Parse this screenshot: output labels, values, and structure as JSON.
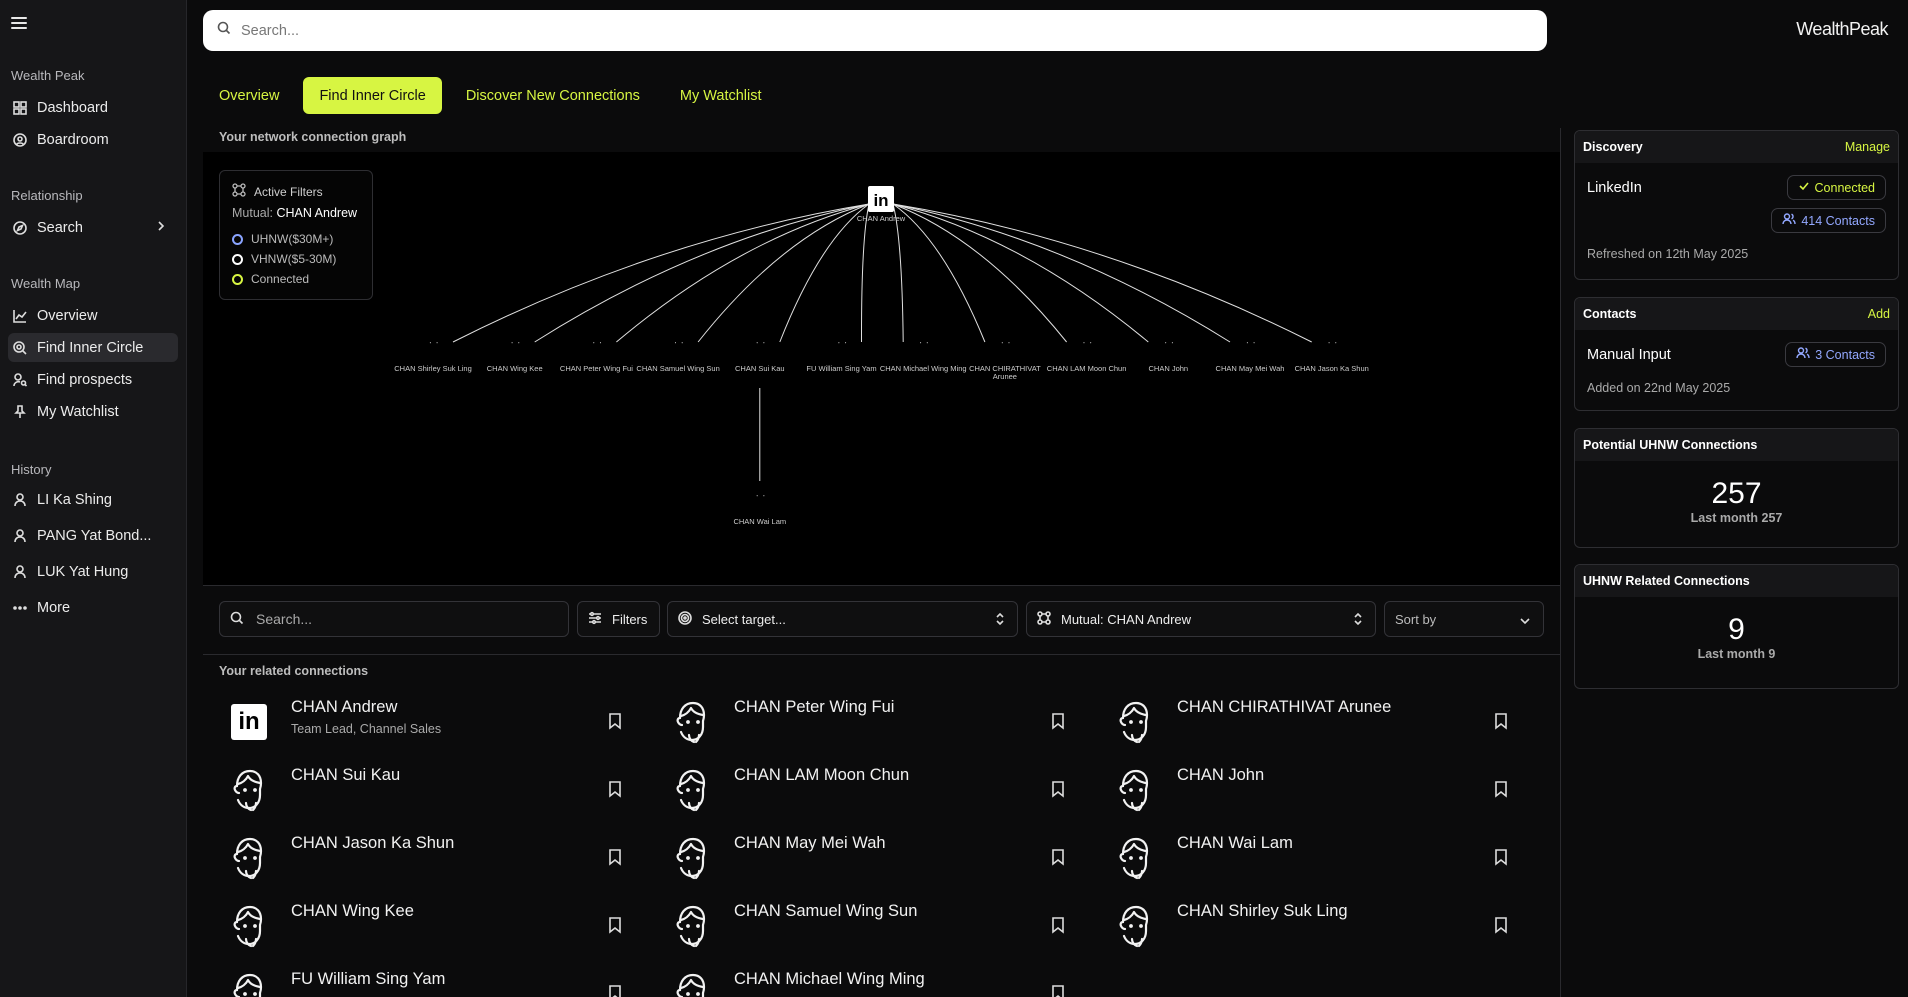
{
  "brand": "WealthPeak",
  "search_placeholder": "Search...",
  "sidebar": {
    "sections": [
      {
        "title": "Wealth Peak",
        "items": [
          {
            "label": "Dashboard",
            "icon": "grid-icon"
          },
          {
            "label": "Boardroom",
            "icon": "person-circle-icon"
          }
        ]
      },
      {
        "title": "Relationship",
        "items": [
          {
            "label": "Search",
            "icon": "compass-icon"
          }
        ]
      },
      {
        "title": "Wealth Map",
        "items": [
          {
            "label": "Overview",
            "icon": "chart-line-icon"
          },
          {
            "label": "Find Inner Circle",
            "icon": "search-circle-icon"
          },
          {
            "label": "Find prospects",
            "icon": "user-search-icon"
          },
          {
            "label": "My Watchlist",
            "icon": "pin-icon"
          }
        ]
      },
      {
        "title": "History",
        "items": [
          {
            "label": "LI Ka Shing",
            "icon": "user-icon"
          },
          {
            "label": "PANG Yat Bond...",
            "icon": "user-icon"
          },
          {
            "label": "LUK Yat Hung",
            "icon": "user-icon"
          },
          {
            "label": "More",
            "icon": "more-icon"
          }
        ]
      }
    ]
  },
  "tabs": [
    "Overview",
    "Find Inner Circle",
    "Discover New Connections",
    "My Watchlist"
  ],
  "active_tab": "Find Inner Circle",
  "graph": {
    "label": "Your network connection graph",
    "filters": {
      "title": "Active Filters",
      "mutual_prefix": "Mutual:",
      "mutual_name": "CHAN Andrew",
      "legend": [
        "UHNW($30M+)",
        "VHNW($5-30M)",
        "Connected"
      ]
    },
    "center": "CHAN Andrew",
    "nodes": [
      "CHAN Shirley Suk Ling",
      "CHAN Wing Kee",
      "CHAN Peter Wing Fui",
      "CHAN Samuel Wing Sun",
      "CHAN Sui Kau",
      "FU William Sing Yam",
      "CHAN Michael Wing Ming",
      "CHAN CHIRATHIVAT Arunee",
      "CHAN LAM Moon Chun",
      "CHAN John",
      "CHAN May Mei Wah",
      "CHAN Jason Ka Shun"
    ],
    "child": "CHAN Wai Lam"
  },
  "right_panel": {
    "discovery": {
      "title": "Discovery",
      "action": "Manage",
      "source": "LinkedIn",
      "status": "Connected",
      "contacts": "414 Contacts",
      "refreshed": "Refreshed on 12th May 2025"
    },
    "contacts": {
      "title": "Contacts",
      "action": "Add",
      "source": "Manual Input",
      "contacts": "3 Contacts",
      "added": "Added on 22nd May 2025"
    },
    "potential": {
      "title": "Potential UHNW Connections",
      "value": "257",
      "last_month": "Last month 257"
    },
    "related": {
      "title": "UHNW Related Connections",
      "value": "9",
      "last_month": "Last month 9"
    }
  },
  "toolbar": {
    "search_placeholder": "Search...",
    "filters": "Filters",
    "target": "Select target...",
    "mutual": "Mutual: CHAN Andrew",
    "sort": "Sort by"
  },
  "related_label": "Your related connections",
  "connections": [
    {
      "name": "CHAN Andrew",
      "role": "Team Lead, Channel Sales",
      "linkedin": true
    },
    {
      "name": "CHAN Peter Wing Fui"
    },
    {
      "name": "CHAN CHIRATHIVAT Arunee"
    },
    {
      "name": "CHAN Sui Kau"
    },
    {
      "name": "CHAN LAM Moon Chun"
    },
    {
      "name": "CHAN John"
    },
    {
      "name": "CHAN Jason Ka Shun"
    },
    {
      "name": "CHAN May Mei Wah"
    },
    {
      "name": "CHAN Wai Lam"
    },
    {
      "name": "CHAN Wing Kee"
    },
    {
      "name": "CHAN Samuel Wing Sun"
    },
    {
      "name": "CHAN Shirley Suk Ling"
    },
    {
      "name": "FU William Sing Yam"
    },
    {
      "name": "CHAN Michael Wing Ming"
    }
  ]
}
